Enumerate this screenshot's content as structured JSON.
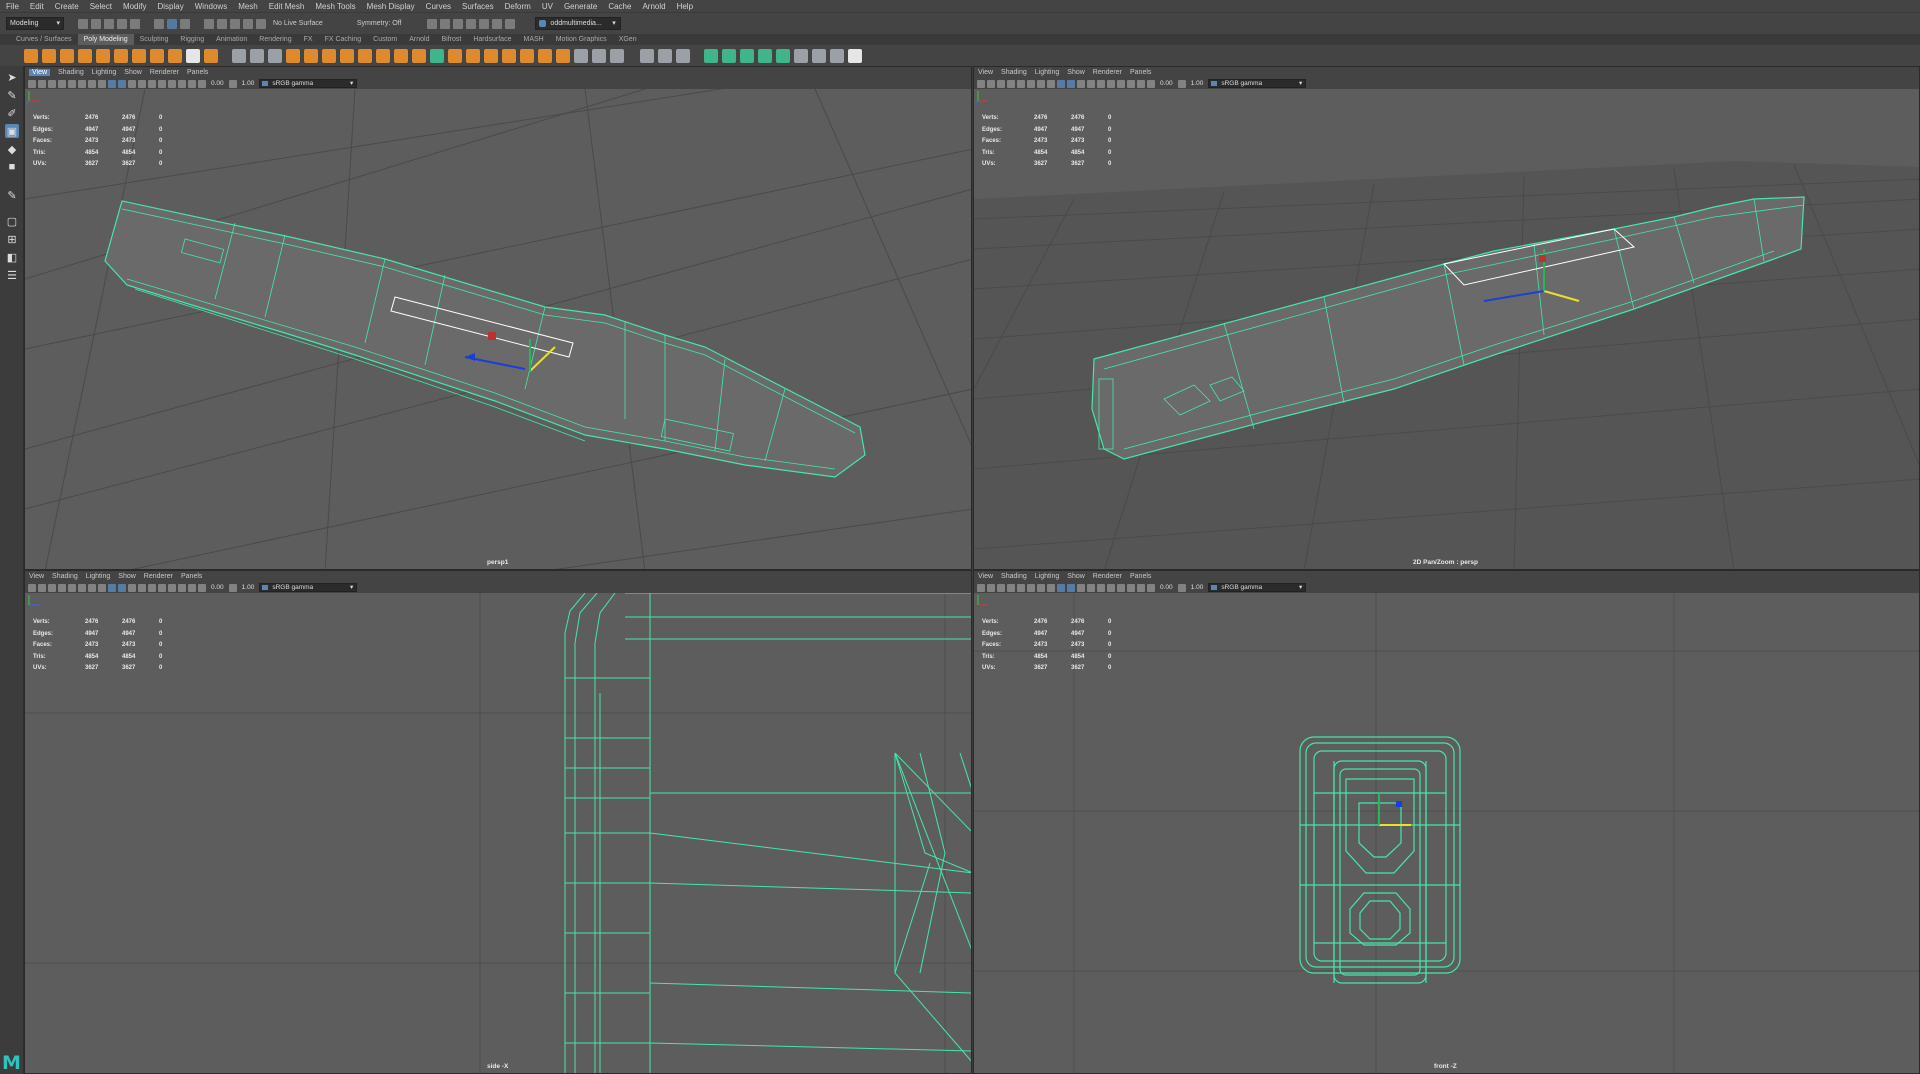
{
  "menubar": [
    "File",
    "Edit",
    "Create",
    "Select",
    "Modify",
    "Display",
    "Windows",
    "Mesh",
    "Edit Mesh",
    "Mesh Tools",
    "Mesh Display",
    "Curves",
    "Surfaces",
    "Deform",
    "UV",
    "Generate",
    "Cache",
    "Arnold",
    "Help"
  ],
  "status": {
    "mode": "Modeling",
    "live_surface": "No Live Surface",
    "symmetry": "Symmetry: Off",
    "workspace": "oddmultimedia..."
  },
  "shelf_tabs": [
    "Curves / Surfaces",
    "Poly Modeling",
    "Sculpting",
    "Rigging",
    "Animation",
    "Rendering",
    "FX",
    "FX Caching",
    "Custom",
    "Arnold",
    "Bifrost",
    "Hardsurface",
    "MASH",
    "Motion Graphics",
    "XGen"
  ],
  "shelf_active": "Poly Modeling",
  "panel_menu": [
    "View",
    "Shading",
    "Lighting",
    "Show",
    "Renderer",
    "Panels"
  ],
  "panel_toolbar": {
    "exposure": "0.00",
    "gamma": "1.00",
    "color_space": "sRGB gamma"
  },
  "hud": [
    {
      "label": "Verts:",
      "a": "2476",
      "b": "2476",
      "c": "0"
    },
    {
      "label": "Edges:",
      "a": "4947",
      "b": "4947",
      "c": "0"
    },
    {
      "label": "Faces:",
      "a": "2473",
      "b": "2473",
      "c": "0"
    },
    {
      "label": "Tris:",
      "a": "4854",
      "b": "4854",
      "c": "0"
    },
    {
      "label": "UVs:",
      "a": "3627",
      "b": "3627",
      "c": "0"
    }
  ],
  "panels": {
    "tl": {
      "camera": "persp1"
    },
    "tr": {
      "camera": "2D Pan/Zoom : persp"
    },
    "bl": {
      "camera": "side -X"
    },
    "br": {
      "camera": "front -Z"
    }
  },
  "colors": {
    "wire": "#46e6a8",
    "viewport_bg": "#5d5d5d",
    "selection": "#5a86b5",
    "shelf_icon": "#e08a2e"
  },
  "logo": "M"
}
